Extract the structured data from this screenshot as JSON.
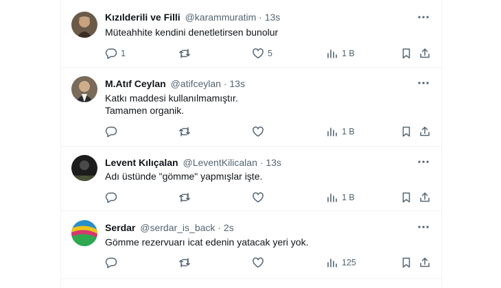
{
  "tweets": [
    {
      "name": "Kızılderili ve Filli",
      "handle": "@karammuratim",
      "time": "13s",
      "lines": [
        "Müteahhite kendini denetletirsen bunolur"
      ],
      "replies": "1",
      "reposts": "",
      "likes": "5",
      "views": "1 B"
    },
    {
      "name": "M.Atıf Ceylan",
      "handle": "@atifceylan",
      "time": "13s",
      "lines": [
        "Katkı maddesi kullanılmamıştır.",
        "Tamamen organik."
      ],
      "replies": "",
      "reposts": "",
      "likes": "",
      "views": "1 B"
    },
    {
      "name": "Levent Kılıçalan",
      "handle": "@LeventKilicalan",
      "time": "13s",
      "lines": [
        "Adı üstünde \"gömme\" yapmışlar işte."
      ],
      "replies": "",
      "reposts": "",
      "likes": "",
      "views": "1 B"
    },
    {
      "name": "Serdar",
      "handle": "@serdar_is_back",
      "time": "2s",
      "lines": [
        "Gömme rezervuarı icat edenin yatacak yeri yok."
      ],
      "replies": "",
      "reposts": "",
      "likes": "",
      "views": "125"
    }
  ],
  "separator": "·",
  "colors": {
    "text": "#0f1419",
    "secondary": "#536471",
    "divider": "#eff3f4"
  }
}
